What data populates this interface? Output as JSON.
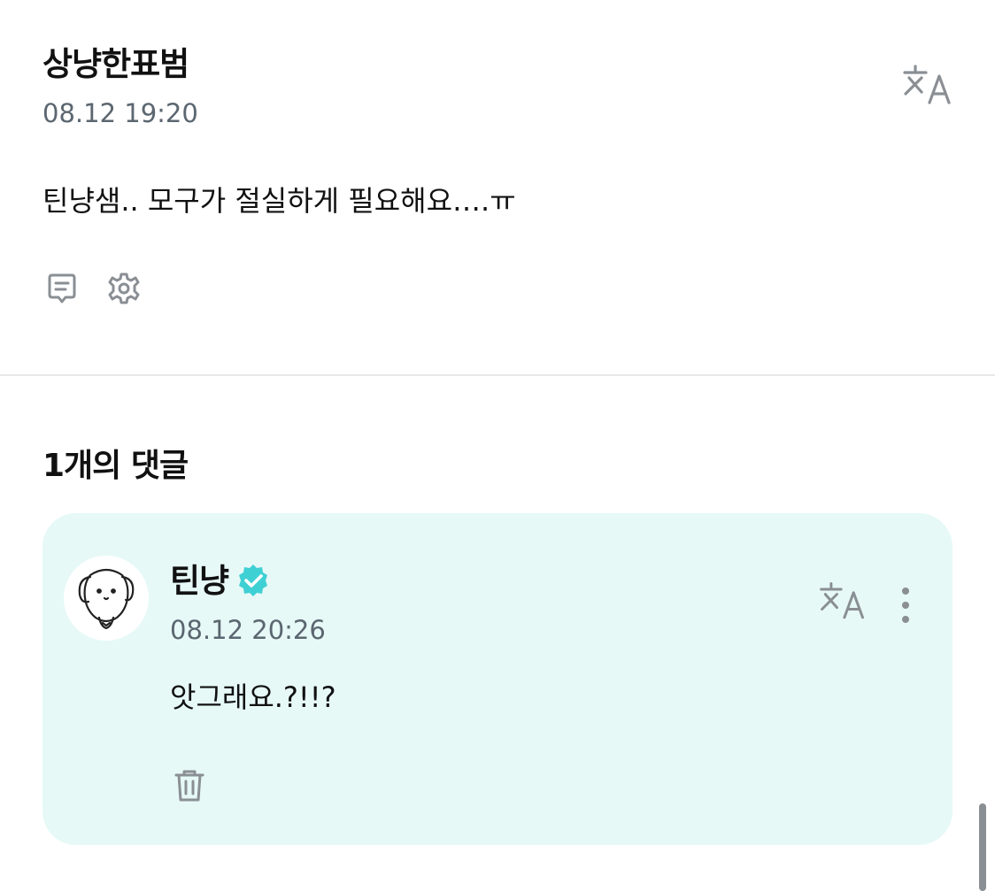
{
  "post": {
    "author": "상냥한표범",
    "date": "08.12 19:20",
    "body": "틴냥샘.. 모구가 절실하게 필요해요….ㅠ",
    "icons": {
      "translate": "translate-icon",
      "comment": "comment-icon",
      "settings": "gear-icon"
    }
  },
  "comments": {
    "title": "1개의 댓글",
    "items": [
      {
        "author": "틴냥",
        "verified": true,
        "date": "08.12 20:26",
        "body": "앗그래요.?!!?",
        "icons": {
          "avatar": "dog-avatar",
          "translate": "translate-icon",
          "more": "more-vertical-icon",
          "delete": "trash-icon"
        }
      }
    ]
  },
  "colors": {
    "card_bg": "#e6f9f7",
    "verified": "#3fd0d4",
    "meta_text": "#5b6670",
    "icon_gray": "#8a8f94"
  }
}
